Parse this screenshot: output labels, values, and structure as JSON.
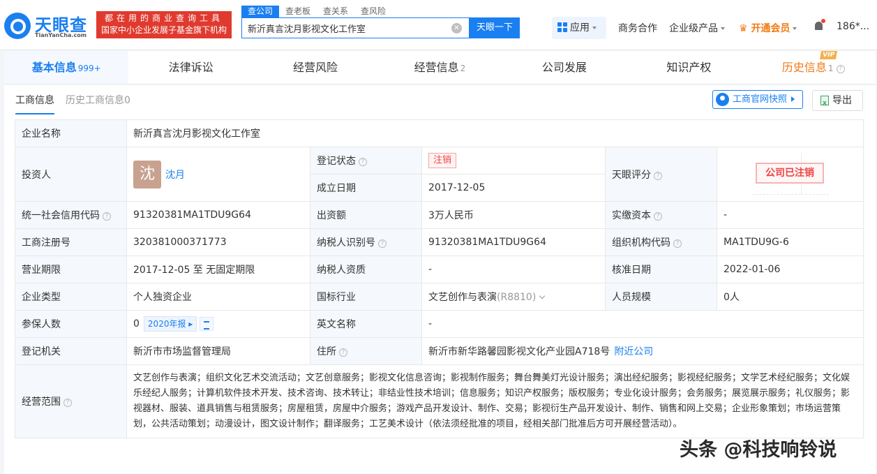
{
  "header": {
    "logo_text": "天眼查",
    "logo_sub": "TianYanCha.com",
    "slogan_line1": "都在用的商业查询工具",
    "slogan_line2": "国家中小企业发展子基金旗下机构",
    "search_tabs": [
      "查公司",
      "查老板",
      "查关系",
      "查风险"
    ],
    "search_value": "新沂真言沈月影视文化工作室",
    "search_button": "天眼一下",
    "apps_label": "应用",
    "nav_business": "商务合作",
    "nav_enterprise": "企业级产品",
    "nav_vip": "开通会员",
    "user": "186*..."
  },
  "tabs": [
    {
      "label": "基本信息",
      "count": "999+"
    },
    {
      "label": "法律诉讼",
      "count": ""
    },
    {
      "label": "经营风险",
      "count": ""
    },
    {
      "label": "经营信息",
      "count": "2"
    },
    {
      "label": "公司发展",
      "count": ""
    },
    {
      "label": "知识产权",
      "count": ""
    },
    {
      "label": "历史信息",
      "count": "1",
      "badge": "VIP"
    }
  ],
  "subtabs": {
    "current": "工商信息",
    "history": "历史工商信息0"
  },
  "actions": {
    "official_snapshot": "工商官网快照",
    "export": "导出"
  },
  "info": {
    "company_name_label": "企业名称",
    "company_name": "新沂真言沈月影视文化工作室",
    "investor_label": "投资人",
    "investor_avatar": "沈",
    "investor_name": "沈月",
    "reg_status_label": "登记状态",
    "reg_status": "注销",
    "est_date_label": "成立日期",
    "est_date": "2017-12-05",
    "score_label": "天眼评分",
    "score_stamp": "公司已注销",
    "credit_code_label": "统一社会信用代码",
    "credit_code": "91320381MA1TDU9G64",
    "capital_label": "出资额",
    "capital": "3万人民币",
    "paid_capital_label": "实缴资本",
    "paid_capital": "-",
    "reg_no_label": "工商注册号",
    "reg_no": "320381000371773",
    "taxpayer_id_label": "纳税人识别号",
    "taxpayer_id": "91320381MA1TDU9G64",
    "org_code_label": "组织机构代码",
    "org_code": "MA1TDU9G-6",
    "term_label": "营业期限",
    "term": "2017-12-05 至 无固定期限",
    "taxpayer_qual_label": "纳税人资质",
    "taxpayer_qual": "-",
    "approve_date_label": "核准日期",
    "approve_date": "2022-01-06",
    "type_label": "企业类型",
    "type": "个人独资企业",
    "industry_label": "国标行业",
    "industry": "文艺创作与表演",
    "industry_code": "(R8810)",
    "staff_label": "人员规模",
    "staff": "0人",
    "insured_label": "参保人数",
    "insured": "0",
    "insured_report": "2020年报",
    "english_name_label": "英文名称",
    "english_name": "-",
    "authority_label": "登记机关",
    "authority": "新沂市市场监督管理局",
    "address_label": "住所",
    "address": "新沂市新华路馨园影视文化产业园A718号",
    "nearby": "附近公司",
    "scope_label": "经营范围",
    "scope": "文艺创作与表演；组织文化艺术交流活动；文艺创意服务；影视文化信息咨询；影视制作服务；舞台舞美灯光设计服务；演出经纪服务；影视经纪服务；文学艺术经纪服务；文化娱乐经纪人服务；计算机软件技术开发、技术咨询、技术转让；非结业性技术培训；信息服务；知识产权服务；版权服务；专业化设计服务；会务服务；展览展示服务；礼仪服务；影视器材、服装、道具销售与租赁服务；房屋租赁，房屋中介服务；游戏产品开发设计、制作、交易；影视衍生产品开发设计、制作、销售和网上交易；企业形象策划；市场运营策划，公共活动策划；动漫设计，图文设计制作；翻译服务；工艺美术设计（依法须经批准的项目，经相关部门批准后方可开展经营活动）。"
  },
  "watermark": "头条 @科技响铃说"
}
